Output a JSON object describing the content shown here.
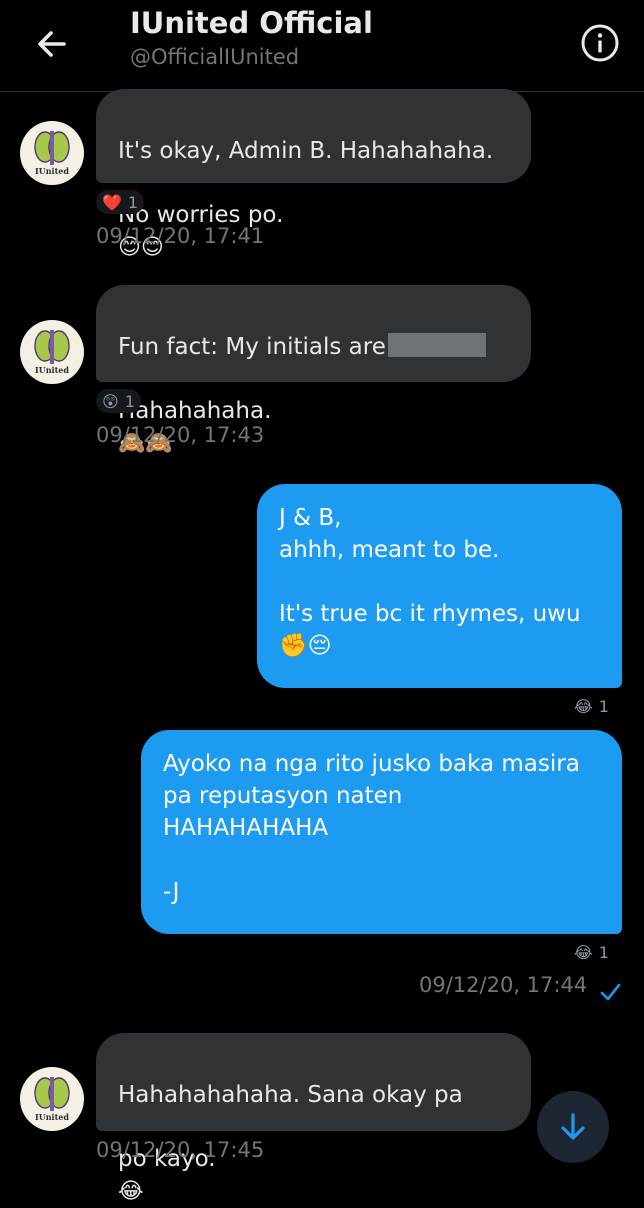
{
  "header": {
    "title": "IUnited Official",
    "handle": "@OfficialIUnited"
  },
  "messages": [
    {
      "line1": "It's okay, Admin B. Hahahahaha.",
      "line2": "No worries po.",
      "emojis": "😊😊",
      "reaction_emoji": "❤️",
      "reaction_count": "1",
      "timestamp": "09/12/20, 17:41"
    },
    {
      "line1": "Fun fact: My initials are",
      "line2": "Hahahahaha.",
      "emojis": "🙈🙈",
      "reaction_emoji": "😲",
      "reaction_count": "1",
      "timestamp": "09/12/20, 17:43"
    },
    {
      "text": "J & B,\nahhh, meant to be.\n\nIt's true bc it rhymes, uwu\n✊😔",
      "reaction_emoji": "😂",
      "reaction_count": "1"
    },
    {
      "text": "Ayoko na nga rito jusko baka masira\npa reputasyon naten\nHAHAHAHAHA\n\n-J",
      "reaction_emoji": "😂",
      "reaction_count": "1",
      "timestamp": "09/12/20, 17:44"
    },
    {
      "line1": "Hahahahahaha. Sana okay pa",
      "line2": "po kayo.",
      "emojis": "😂",
      "timestamp": "09/12/20, 17:45"
    }
  ],
  "avatar": {
    "brand": "IUnited",
    "sub": "est. 2020"
  },
  "colors": {
    "background": "#000000",
    "incoming_bubble": "#2f3336",
    "outgoing_bubble": "#1d9bf0",
    "timestamp": "#71767b",
    "scroll_button": "#1c2733"
  },
  "icons": {
    "back": "arrow-left-icon",
    "info": "info-circle-icon",
    "sent": "check-icon",
    "scroll": "arrow-down-icon"
  }
}
